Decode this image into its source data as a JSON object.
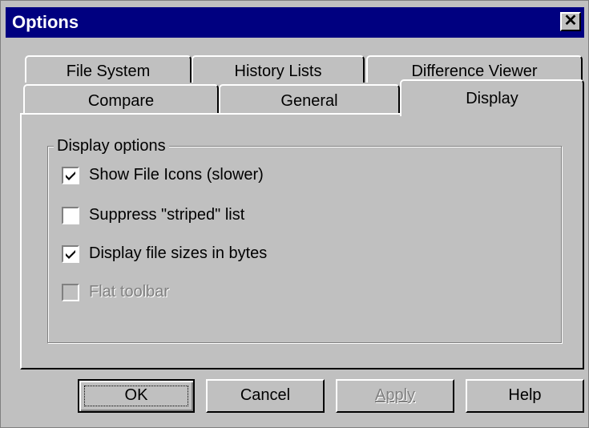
{
  "window": {
    "title": "Options",
    "close_glyph": "✕"
  },
  "tabs_back": [
    {
      "label": "File System"
    },
    {
      "label": "History Lists"
    },
    {
      "label": "Difference Viewer"
    }
  ],
  "tabs_front": [
    {
      "label": "Compare"
    },
    {
      "label": "General"
    },
    {
      "label": "Display",
      "active": true
    }
  ],
  "group": {
    "title": "Display options",
    "options": [
      {
        "label": "Show File Icons (slower)",
        "checked": true,
        "enabled": true
      },
      {
        "label": "Suppress \"striped\" list",
        "checked": false,
        "enabled": true
      },
      {
        "label": "Display file sizes in bytes",
        "checked": true,
        "enabled": true
      },
      {
        "label": "Flat toolbar",
        "checked": false,
        "enabled": false
      }
    ]
  },
  "buttons": {
    "ok": "OK",
    "cancel": "Cancel",
    "apply": "Apply",
    "help": "Help"
  },
  "colors": {
    "face": "#c0c0c0",
    "titlebar": "#000080",
    "shadow": "#808080",
    "highlight": "#ffffff"
  }
}
